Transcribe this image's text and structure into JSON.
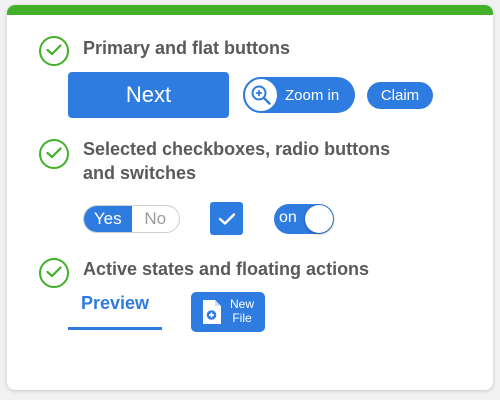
{
  "theme": {
    "accent": "#2f7ce0",
    "top_bar": "#43b02a",
    "check_green": "#43b02a",
    "title_text": "#5a5a5a"
  },
  "icons": {
    "section_check": "check-circle-icon",
    "zoom": "zoom-in-icon",
    "checkbox": "checkmark-icon",
    "new_file": "file-plus-icon"
  },
  "sections": [
    {
      "title": "Primary and flat buttons"
    },
    {
      "title_line1": "Selected checkboxes, radio buttons",
      "title_line2": "and switches"
    },
    {
      "title": "Active states and floating actions"
    }
  ],
  "buttons": {
    "next_label": "Next",
    "zoom_label": "Zoom in",
    "claim_label": "Claim"
  },
  "toggles": {
    "yes_label": "Yes",
    "no_label": "No",
    "yes_selected": true,
    "checkbox_checked": true,
    "switch_label": "on",
    "switch_on": true
  },
  "active": {
    "tab_label": "Preview",
    "new_file_line1": "New",
    "new_file_line2": "File"
  }
}
